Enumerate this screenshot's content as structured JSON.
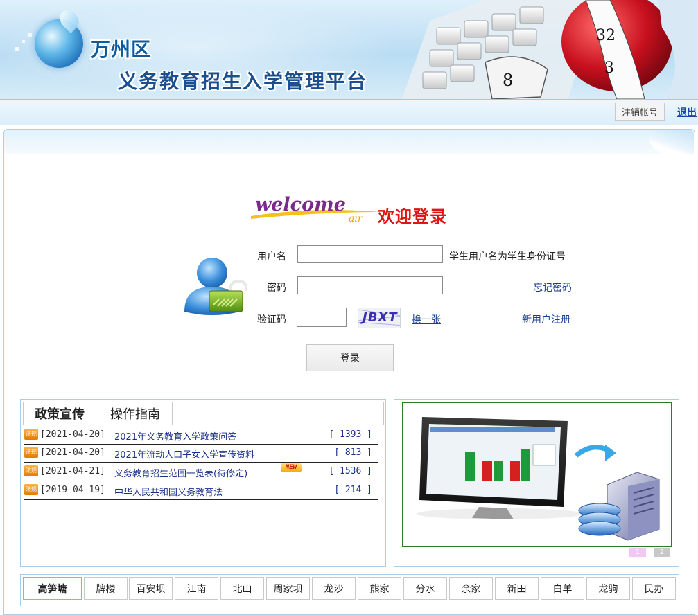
{
  "header": {
    "district": "万州区",
    "platform": "义务教育招生入学管理平台"
  },
  "topbar": {
    "logout_label": "注销帐号",
    "exit_label": "退出"
  },
  "login": {
    "welcome_en": "welcome",
    "welcome_air": "air",
    "welcome_cn": "欢迎登录",
    "username_label": "用户名",
    "username_value": "",
    "username_hint": "学生用户名为学生身份证号",
    "password_label": "密码",
    "password_value": "",
    "forgot_label": "忘记密码",
    "captcha_label": "验证码",
    "captcha_value": "",
    "captcha_text": "JBXT",
    "refresh_label": "换一张",
    "register_label": "新用户注册",
    "submit_label": "登录"
  },
  "news": {
    "tabs": [
      "政策宣传",
      "操作指南"
    ],
    "active_tab": 0,
    "icon_text": "法规",
    "new_badge": "NEW",
    "items": [
      {
        "date": "[2021-04-20]",
        "title": "2021年义务教育入学政策问答",
        "count": "[ 1393 ]"
      },
      {
        "date": "[2021-04-20]",
        "title": "2021年流动人口子女入学宣传资料",
        "count": "[ 813 ]"
      },
      {
        "date": "[2021-04-21]",
        "title": "义务教育招生范围一览表(待修定)",
        "count": "[ 1536 ]"
      },
      {
        "date": "[2019-04-19]",
        "title": "中华人民共和国义务教育法",
        "count": "[ 214 ]"
      }
    ]
  },
  "slideshow": {
    "pages": [
      "1",
      "2"
    ],
    "active_page": 0
  },
  "districts": {
    "active": 0,
    "items": [
      "高笋塘",
      "牌楼",
      "百安坝",
      "江南",
      "北山",
      "周家坝",
      "龙沙",
      "熊家",
      "分水",
      "余家",
      "新田",
      "白羊",
      "龙驹",
      "民办"
    ]
  },
  "colors": {
    "brand_blue": "#1b4f8f",
    "welcome_red": "#e31414",
    "link_blue": "#1a2f8c"
  }
}
